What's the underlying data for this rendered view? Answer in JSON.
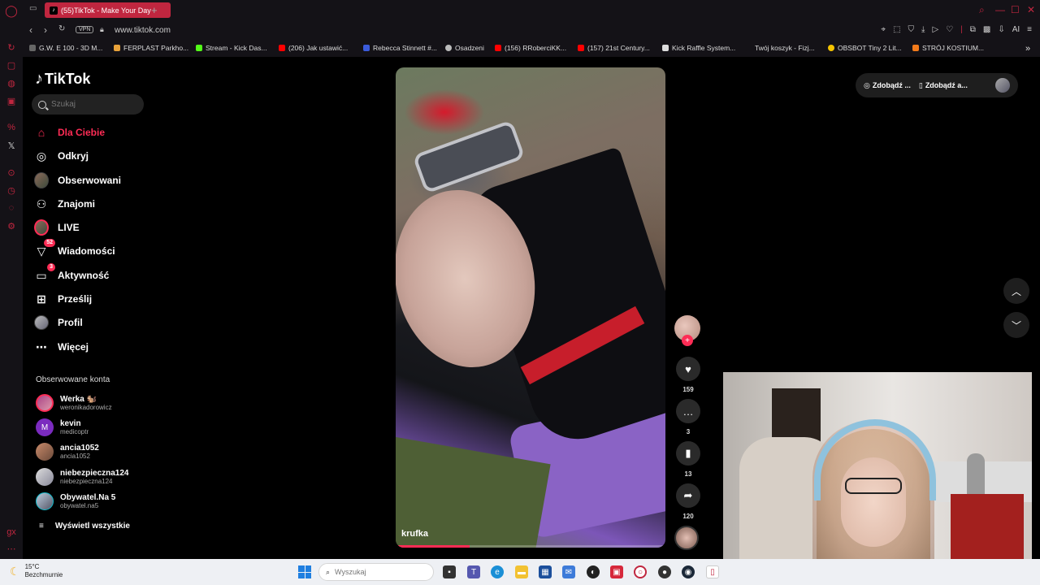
{
  "browser": {
    "tab_title": "(55)TikTok - Make Your Day",
    "url": "www.tiktok.com",
    "vpn_label": "VPN",
    "ai_label": "AI",
    "bookmarks": [
      {
        "label": "G.W. E 100 - 3D M...",
        "color": "#666"
      },
      {
        "label": "FERPLAST Parkho...",
        "color": "#e8a23a"
      },
      {
        "label": "Stream - Kick Das...",
        "color": "#53fc18"
      },
      {
        "label": "(206) Jak ustawić...",
        "color": "#ff0000"
      },
      {
        "label": "Rebecca Stinnett #...",
        "color": "#3b5bdb"
      },
      {
        "label": "Osadzeni",
        "color": "#bbb"
      },
      {
        "label": "(156) RRoberciKK...",
        "color": "#ff0000"
      },
      {
        "label": "(157) 21st Century...",
        "color": "#ff0000"
      },
      {
        "label": "Kick Raffle System...",
        "color": "#ddd"
      },
      {
        "label": "Twój koszyk - Fizj...",
        "color": "#141217"
      },
      {
        "label": "OBSBOT Tiny 2 Lit...",
        "color": "#f5c400"
      },
      {
        "label": "STRÓJ KOSTIUM...",
        "color": "#f27a1a"
      }
    ]
  },
  "tiktok": {
    "logo": "TikTok",
    "search_placeholder": "Szukaj",
    "nav": [
      {
        "label": "Dla Ciebie",
        "icon": "home-icon"
      },
      {
        "label": "Odkryj",
        "icon": "compass-icon"
      },
      {
        "label": "Obserwowani",
        "icon": "avatar"
      },
      {
        "label": "Znajomi",
        "icon": "friends-icon"
      },
      {
        "label": "LIVE",
        "icon": "live-avatar"
      },
      {
        "label": "Wiadomości",
        "icon": "inbox-icon",
        "badge": "52"
      },
      {
        "label": "Aktywność",
        "icon": "activity-icon",
        "badge": "3"
      },
      {
        "label": "Prześlij",
        "icon": "upload-icon"
      },
      {
        "label": "Profil",
        "icon": "profile-avatar"
      },
      {
        "label": "Więcej",
        "icon": "more-icon"
      }
    ],
    "following_title": "Obserwowane konta",
    "following": [
      {
        "name": "Werka 🐿️",
        "user": "weronikadorowicz"
      },
      {
        "name": "kevin",
        "user": "medicoptr",
        "initial": "M"
      },
      {
        "name": "ancia1052",
        "user": "ancia1052"
      },
      {
        "name": "niebezpieczna124",
        "user": "niebezpieczna124"
      },
      {
        "name": "Obywatel.Na 5",
        "user": "obywatel.na5"
      }
    ],
    "see_all": "Wyświetl wszystkie",
    "top_actions": [
      "Zdobądź ...",
      "Zdobądź a..."
    ],
    "video": {
      "author": "krufka",
      "progress": 0.27,
      "likes": "159",
      "comments": "3",
      "saves": "13",
      "shares": "120"
    }
  },
  "taskbar": {
    "temperature": "15°C",
    "weather": "Bezchmurnie",
    "search_placeholder": "Wyszukaj"
  }
}
